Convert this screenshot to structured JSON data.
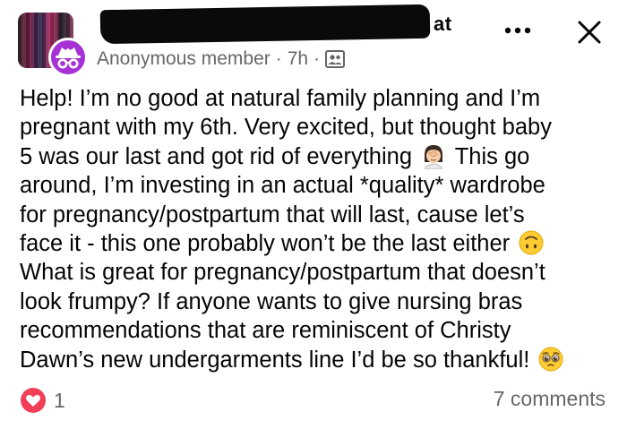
{
  "header": {
    "group_name_visible": "at",
    "author": "Anonymous member",
    "separator": "·",
    "time": "7h",
    "audience_icon": "group-audience-icon",
    "more_icon": "more-options-icon",
    "close_icon": "close-icon"
  },
  "post": {
    "lines": [
      "Help! I’m no good at natural family planning and I’m",
      "pregnant with my 6th. Very excited, but thought baby",
      "5 was our last and got rid of everything",
      "This go",
      "around, I’m investing in an actual *quality* wardrobe",
      "for pregnancy/postpartum that will last, cause let’s",
      "face it - this one probably won’t be the last either",
      "What is great for pregnancy/postpartum that doesn’t",
      "look frumpy? If anyone wants to give nursing bras",
      "recommendations that are reminiscent of Christy",
      "Dawn’s new undergarments line I’d be so thankful!"
    ],
    "emojis": [
      "facepalm-woman-emoji",
      "upside-down-face-emoji",
      "pleading-face-emoji"
    ]
  },
  "footer": {
    "reaction_icon": "love-reaction-icon",
    "reaction_count": "1",
    "comments": "7 comments"
  },
  "colors": {
    "anonymous_avatar": "#a632d6",
    "love_reaction": "#f33e58",
    "secondary_text": "#65676b"
  }
}
